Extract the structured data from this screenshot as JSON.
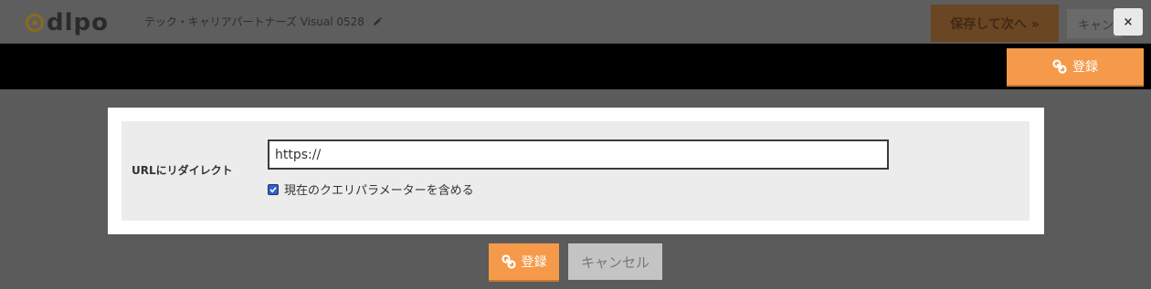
{
  "app": {
    "logo_text": "dlpo",
    "project_title": "テック・キャリアパートナーズ Visual 0528"
  },
  "header": {
    "save_next_label": "保存して次へ »",
    "cancel_label": "キャンセル",
    "close_label": "×"
  },
  "action_bar": {
    "register_label": "登録"
  },
  "form": {
    "redirect_label": "URLにリダイレクト",
    "url_value": "https://",
    "include_query_label": "現在のクエリパラメーターを含める",
    "include_query_checked": true
  },
  "footer": {
    "register_label": "登録",
    "cancel_label": "キャンセル"
  },
  "colors": {
    "accent": "#f59a4a",
    "overlay": "#5b5b5b",
    "bar": "#000000"
  },
  "icons": {
    "link": "link-icon",
    "pencil": "pencil-icon",
    "close": "close-icon"
  }
}
